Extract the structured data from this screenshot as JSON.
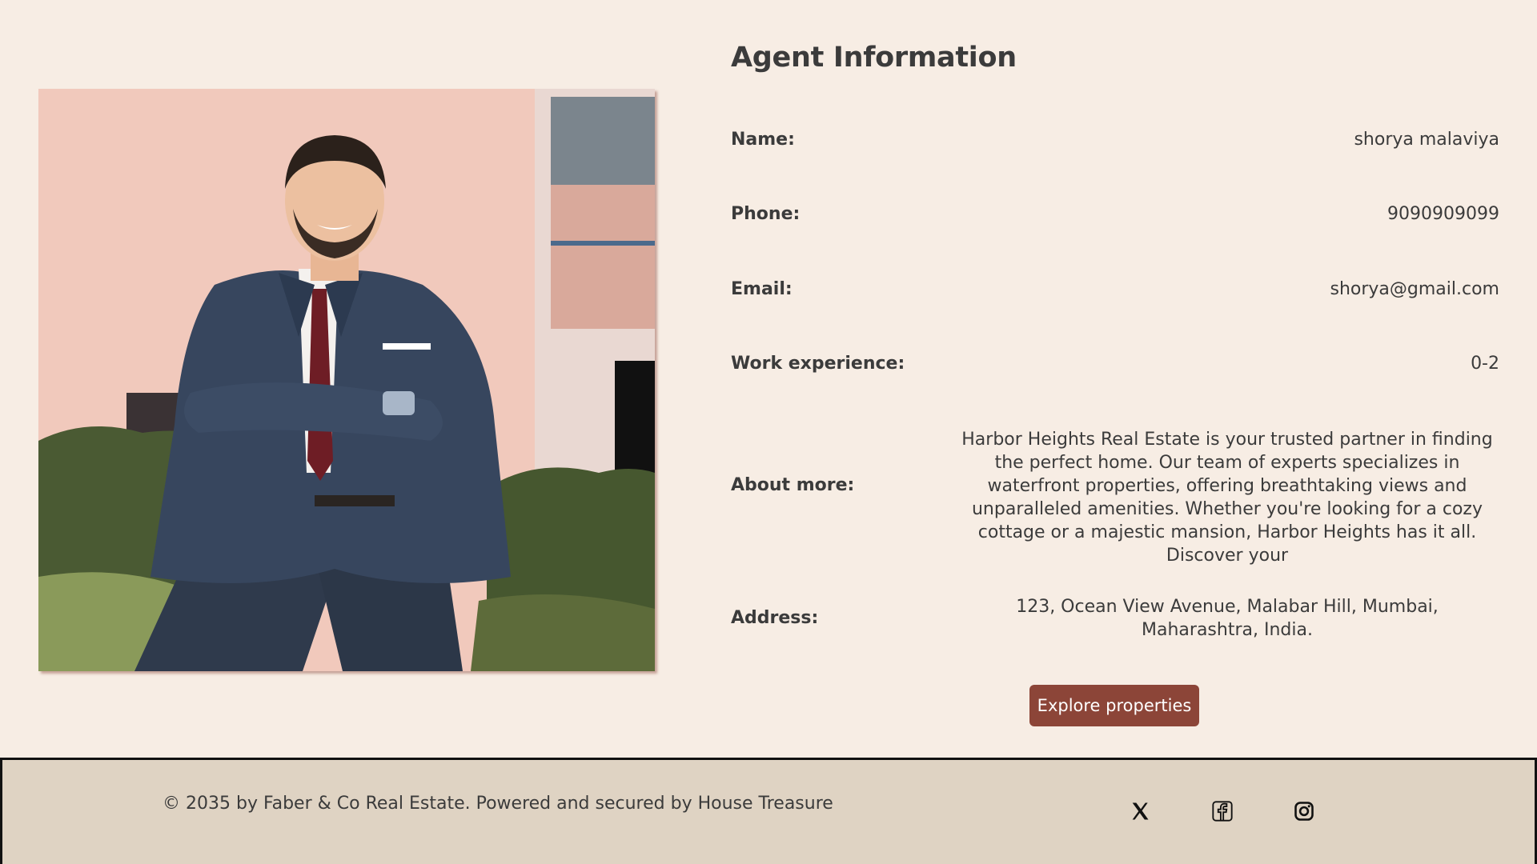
{
  "section_title": "Agent Information",
  "fields": {
    "name": {
      "label": "Name:",
      "value": "shorya malaviya"
    },
    "phone": {
      "label": "Phone:",
      "value": "9090909099"
    },
    "email": {
      "label": "Email:",
      "value": "shorya@gmail.com"
    },
    "experience": {
      "label": "Work experience:",
      "value": "0-2"
    },
    "about": {
      "label": "About more:",
      "value": "Harbor Heights Real Estate is your trusted partner in finding the perfect home. Our team of experts specializes in waterfront properties, offering breathtaking views and unparalleled amenities. Whether you're looking for a cozy cottage or a majestic mansion, Harbor Heights has it all. Discover your"
    },
    "address": {
      "label": "Address:",
      "value": "123, Ocean View Avenue, Malabar Hill, Mumbai, Maharashtra, India."
    }
  },
  "cta": {
    "label": "Explore properties"
  },
  "footer": {
    "copyright": "© 2035 by Faber & Co Real Estate. Powered and secured by House Treasure",
    "social": [
      "x-icon",
      "facebook-icon",
      "instagram-icon"
    ]
  },
  "colors": {
    "background": "#f7ede4",
    "accent": "#8c4538",
    "footer_bg": "#dfd3c3"
  }
}
